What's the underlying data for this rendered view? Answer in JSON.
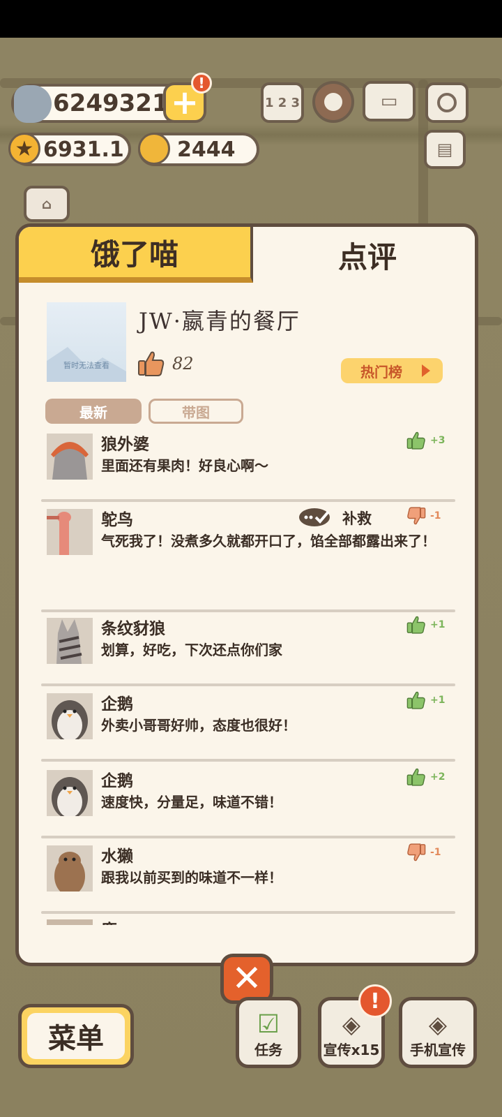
{
  "currency": {
    "fish": "6249321",
    "stars": "6931.1",
    "bells": "2444"
  },
  "top_buttons": {
    "rank_label": "1 2 3"
  },
  "tabs": {
    "left": "饿了喵",
    "right": "点评"
  },
  "restaurant": {
    "image_caption": "暂时无法查看",
    "name": "JW·嬴青的餐厅",
    "likes": "82",
    "hot_list_label": "热门榜"
  },
  "filters": {
    "latest": "最新",
    "with_image": "带图"
  },
  "reviews": [
    {
      "name": "狼外婆",
      "text": "里面还有果肉！好良心啊～",
      "vote": "up",
      "count": "+3",
      "avatar": "wolf-grandma"
    },
    {
      "name": "鸵鸟",
      "text": "气死我了！没煮多久就都开口了，馅全部都露出来了！",
      "vote": "down",
      "count": "-1",
      "rescue": "补救",
      "avatar": "ostrich"
    },
    {
      "name": "条纹豺狼",
      "text": "划算，好吃，下次还点你们家",
      "vote": "up",
      "count": "+1",
      "avatar": "striped-hyena"
    },
    {
      "name": "企鹅",
      "text": "外卖小哥哥好帅，态度也很好！",
      "vote": "up",
      "count": "+1",
      "avatar": "penguin"
    },
    {
      "name": "企鹅",
      "text": "速度快，分量足，味道不错！",
      "vote": "up",
      "count": "+2",
      "avatar": "penguin"
    },
    {
      "name": "水獭",
      "text": "跟我以前买到的味道不一样！",
      "vote": "down",
      "count": "-1",
      "avatar": "otter"
    },
    {
      "name": "鹿",
      "text": "",
      "vote": "up",
      "count": "",
      "avatar": "deer"
    }
  ],
  "bottom": {
    "menu": "菜单",
    "tasks": "任务",
    "promote": "宣传x15",
    "phone_promote": "手机宣传"
  },
  "colors": {
    "up": "#7bb45a",
    "down": "#e2895a",
    "accent": "#fcd04e"
  }
}
